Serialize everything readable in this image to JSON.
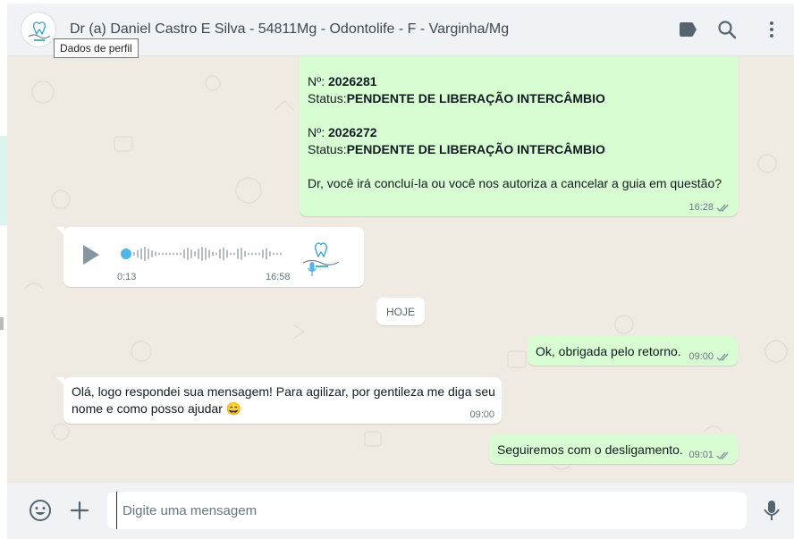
{
  "header": {
    "title": "Dr (a) Daniel Castro E Silva - 54811Mg - Odontolife - F - Varginha/Mg",
    "tooltip": "Dados de perfil",
    "icons": [
      "label-icon",
      "search-icon",
      "menu-icon"
    ]
  },
  "messages": {
    "m1": {
      "line1_label": "Nº: ",
      "line1_value": "2026281",
      "line2_label": "Status:",
      "line2_value": "PENDENTE DE LIBERAÇÃO INTERCÂMBIO",
      "line3_label": "Nº: ",
      "line3_value": "2026272",
      "line4_label": "Status:",
      "line4_value": "PENDENTE DE LIBERAÇÃO INTERCÂMBIO",
      "line5": "Dr, você irá concluí-la ou você nos autoriza a cancelar a guia em questão?",
      "time": "16:28"
    },
    "voice": {
      "duration": "0:13",
      "time": "16:58",
      "progress": 0
    },
    "day": "HOJE",
    "m2": {
      "text": "Ok, obrigada pelo retorno.",
      "time": "09:00"
    },
    "m3": {
      "line1": "Olá, logo respondei sua mensagem! Para agilizar, por gentileza me diga seu",
      "line2": "nome e como posso ajudar",
      "emoji": "😄",
      "time": "09:00"
    },
    "m4": {
      "text": "Seguiremos com o desligamento.",
      "time": "09:01"
    }
  },
  "footer": {
    "placeholder": "Digite uma mensagem",
    "value": ""
  },
  "colors": {
    "outgoing_bubble": "#d9fdd3",
    "incoming_bubble": "#ffffff",
    "chat_background": "#efeae2",
    "read_check": "#8696a0"
  }
}
